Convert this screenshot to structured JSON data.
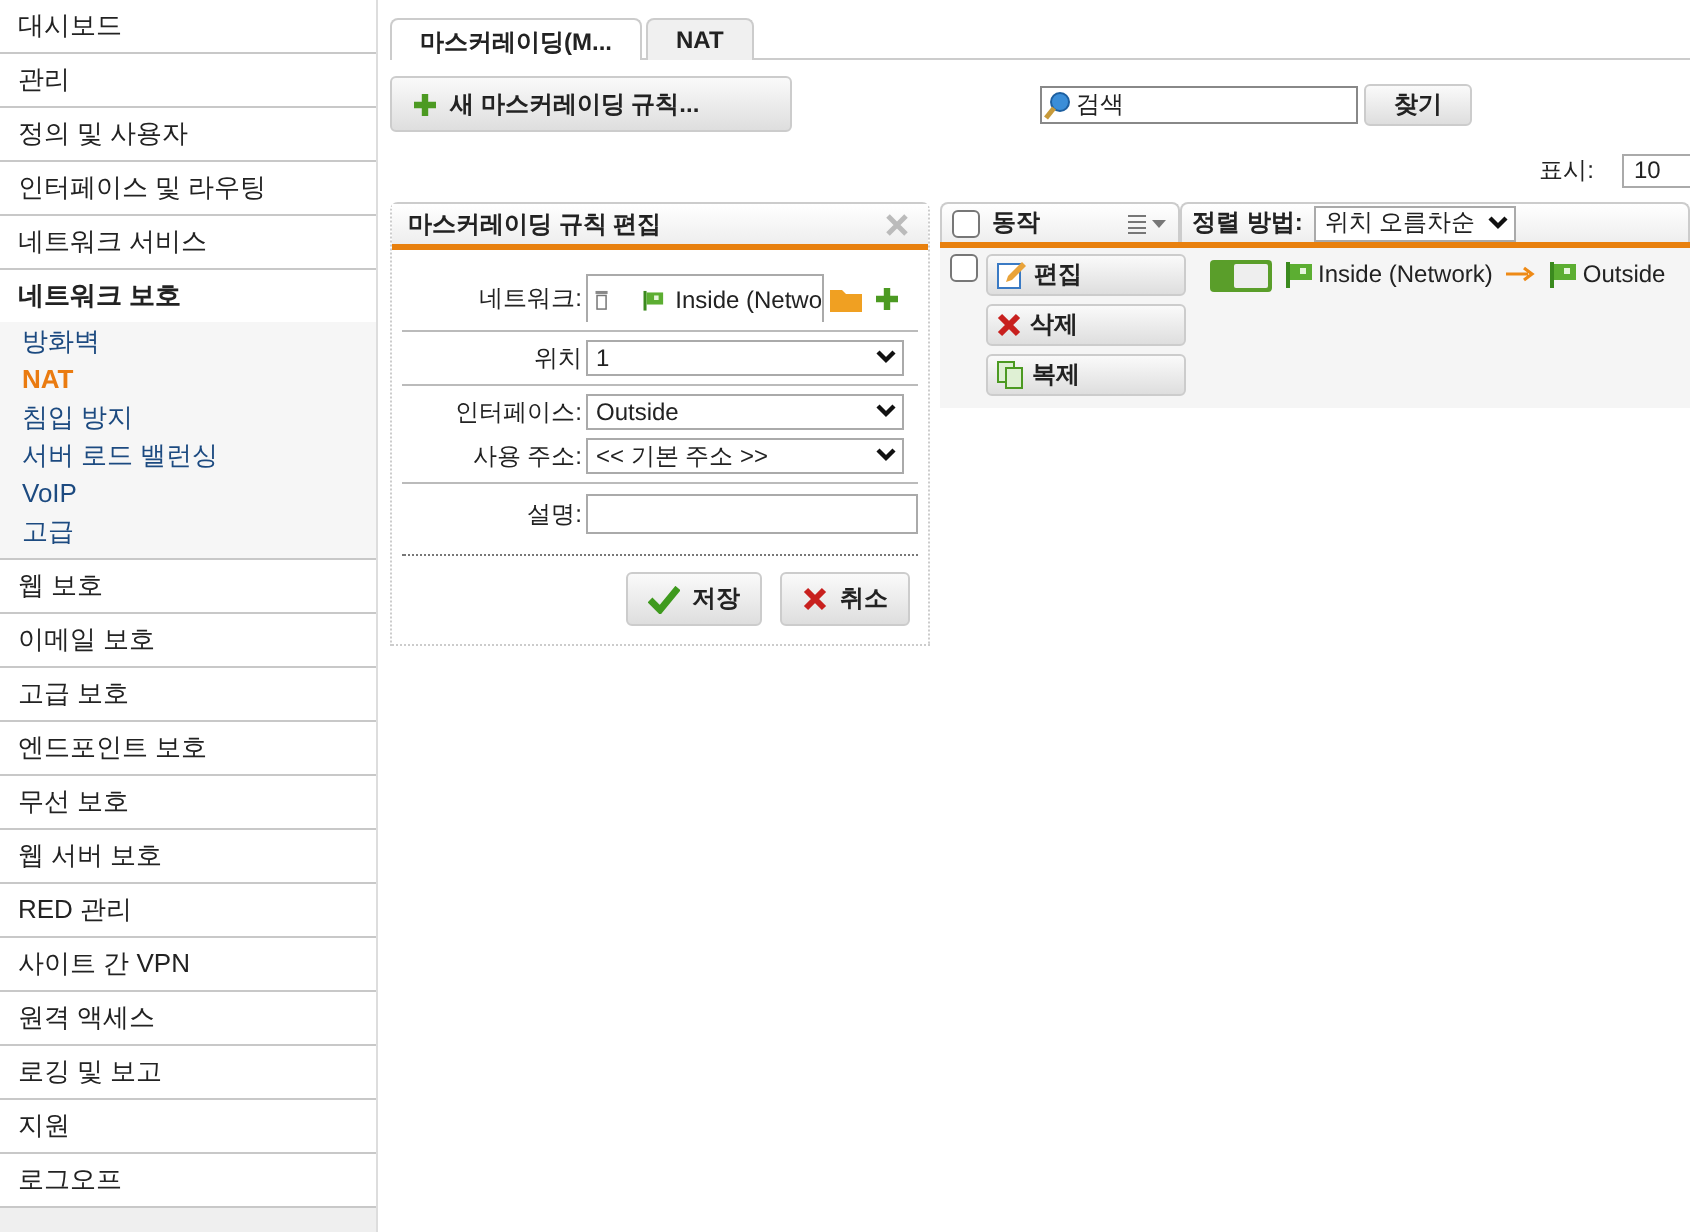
{
  "sidebar": {
    "items": [
      {
        "label": "대시보드",
        "expanded": false
      },
      {
        "label": "관리",
        "expanded": false
      },
      {
        "label": "정의 및 사용자",
        "expanded": false
      },
      {
        "label": "인터페이스 및 라우팅",
        "expanded": false
      },
      {
        "label": "네트워크 서비스",
        "expanded": false
      },
      {
        "label": "네트워크 보호",
        "expanded": true,
        "children": [
          {
            "label": "방화벽",
            "selected": false
          },
          {
            "label": "NAT",
            "selected": true
          },
          {
            "label": "침입 방지",
            "selected": false
          },
          {
            "label": "서버 로드 밸런싱",
            "selected": false
          },
          {
            "label": "VoIP",
            "selected": false
          },
          {
            "label": "고급",
            "selected": false
          }
        ]
      },
      {
        "label": "웹 보호",
        "expanded": false
      },
      {
        "label": "이메일 보호",
        "expanded": false
      },
      {
        "label": "고급 보호",
        "expanded": false
      },
      {
        "label": "엔드포인트 보호",
        "expanded": false
      },
      {
        "label": "무선 보호",
        "expanded": false
      },
      {
        "label": "웹 서버 보호",
        "expanded": false
      },
      {
        "label": "RED 관리",
        "expanded": false
      },
      {
        "label": "사이트 간 VPN",
        "expanded": false
      },
      {
        "label": "원격 액세스",
        "expanded": false
      },
      {
        "label": "로깅 및 보고",
        "expanded": false
      },
      {
        "label": "지원",
        "expanded": false
      },
      {
        "label": "로그오프",
        "expanded": false
      }
    ]
  },
  "tabs": [
    {
      "label": "마스커레이딩(M...",
      "selected": true
    },
    {
      "label": "NAT",
      "selected": false
    }
  ],
  "toolbar": {
    "new_button": "새 마스커레이딩 규칙...",
    "search": {
      "placeholder": "검색"
    },
    "find_button": "찾기",
    "display_label": "표시:",
    "display_value": "10"
  },
  "edit_panel": {
    "title": "마스커레이딩 규칙 편집",
    "groups": [
      [
        {
          "kind": "object",
          "label": "네트워크:",
          "value": "Inside (Netwo"
        }
      ],
      [
        {
          "kind": "select",
          "label": "위치",
          "value": "1"
        }
      ],
      [
        {
          "kind": "select",
          "label": "인터페이스:",
          "value": "Outside"
        },
        {
          "kind": "select",
          "label": "사용 주소:",
          "value": "<< 기본 주소 >>"
        }
      ],
      [
        {
          "kind": "text",
          "label": "설명:"
        }
      ]
    ],
    "buttons": [
      {
        "kind": "save",
        "label": "저장"
      },
      {
        "kind": "cancel",
        "label": "취소"
      }
    ]
  },
  "list": {
    "header": {
      "checked": false,
      "action_label": "동작",
      "sort_label": "정렬 방법:",
      "sort_value": "위치 오름차순"
    },
    "rows": [
      {
        "checked": false,
        "enabled": true,
        "source": "Inside (Network)",
        "target": "Outside",
        "actions": [
          {
            "kind": "edit",
            "label": "편집"
          },
          {
            "kind": "delete",
            "label": "삭제"
          },
          {
            "kind": "clone",
            "label": "복제"
          }
        ]
      }
    ]
  }
}
